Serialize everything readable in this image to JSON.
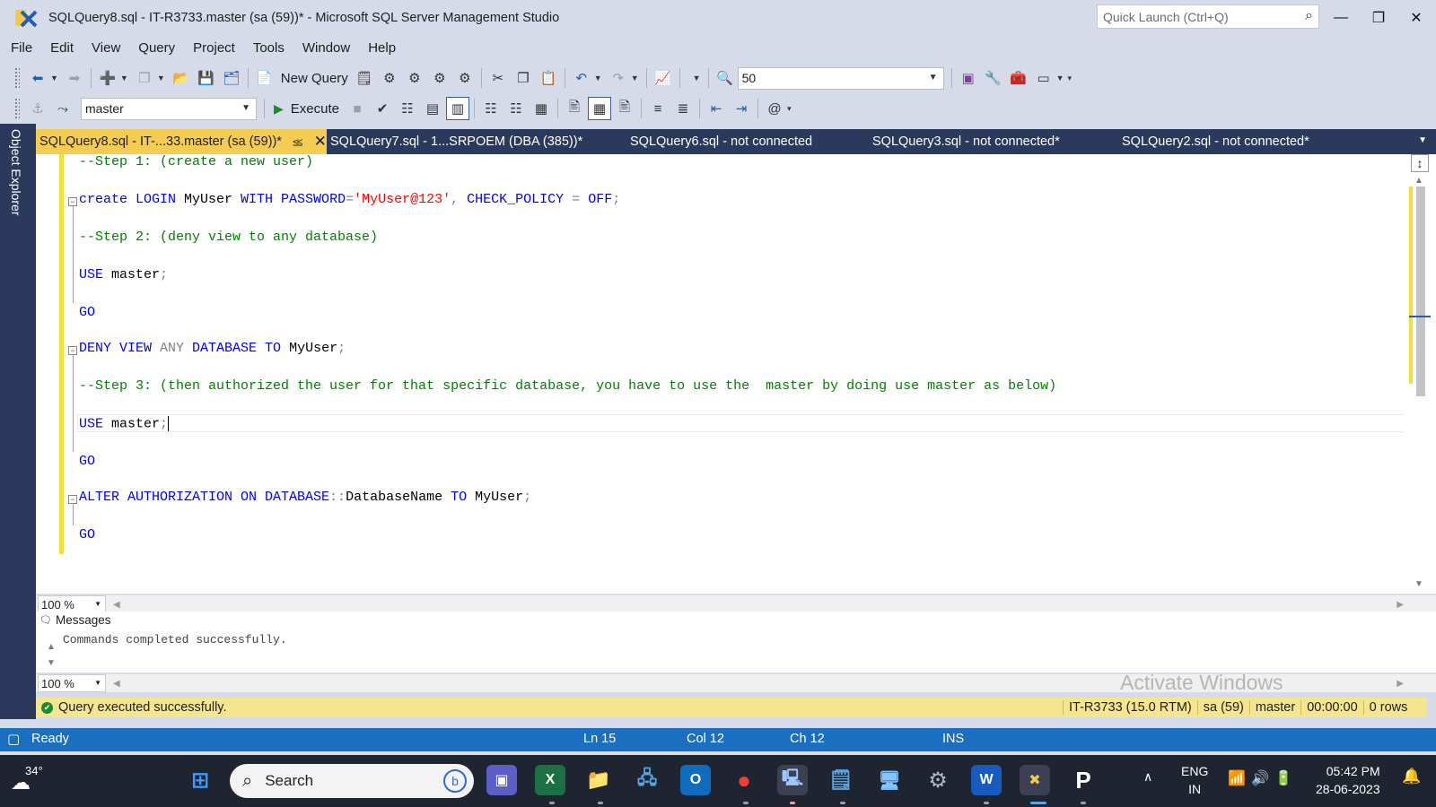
{
  "window": {
    "title": "SQLQuery8.sql - IT-R3733.master (sa (59))* - Microsoft SQL Server Management Studio",
    "quick_launch_placeholder": "Quick Launch (Ctrl+Q)"
  },
  "menu": [
    "File",
    "Edit",
    "View",
    "Query",
    "Project",
    "Tools",
    "Window",
    "Help"
  ],
  "toolbar1": {
    "new_query_label": "New Query",
    "results_combo_value": "50"
  },
  "toolbar2": {
    "database_combo_value": "master",
    "execute_label": "Execute"
  },
  "left_rail": {
    "object_explorer_label": "Object Explorer"
  },
  "tabs": [
    {
      "label": "SQLQuery8.sql - IT-...33.master (sa (59))*",
      "active": true
    },
    {
      "label": "SQLQuery7.sql - 1...SRPOEM (DBA (385))*",
      "active": false
    },
    {
      "label": "SQLQuery6.sql - not connected",
      "active": false
    },
    {
      "label": "SQLQuery3.sql - not connected*",
      "active": false
    },
    {
      "label": "SQLQuery2.sql - not connected*",
      "active": false
    }
  ],
  "editor": {
    "lines": {
      "l1": "--Step 1: (create a new user)",
      "l2_a": "create LOGIN",
      "l2_b": " MyUser ",
      "l2_c": "WITH PASSWORD",
      "l2_d": "=",
      "l2_e": "'MyUser@123'",
      "l2_f": ", ",
      "l2_g": "CHECK_POLICY",
      "l2_h": " = ",
      "l2_i": "OFF",
      "l2_j": ";",
      "l3": "--Step 2: (deny view to any database)",
      "l4_a": "USE",
      "l4_b": " master",
      "l4_c": ";",
      "l5": "GO",
      "l6_a": "DENY VIEW",
      "l6_b": " ANY ",
      "l6_c": "DATABASE TO",
      "l6_d": " MyUser",
      "l6_e": ";",
      "l7": "--Step 3: (then authorized the user for that specific database, you have to use the  master by doing use master as below)",
      "l8_a": "USE",
      "l8_b": " master",
      "l8_c": ";",
      "l9": "GO",
      "l10_a": "ALTER AUTHORIZATION ON DATABASE",
      "l10_b": "::",
      "l10_c": "DatabaseName ",
      "l10_d": "TO",
      "l10_e": " MyUser",
      "l10_f": ";",
      "l11": "GO"
    },
    "zoom": "100 %"
  },
  "results": {
    "tab_label": "Messages",
    "message": "Commands completed successfully.",
    "zoom": "100 %"
  },
  "watermark": "Activate Windows",
  "query_status": {
    "message": "Query executed successfully.",
    "server": "IT-R3733 (15.0 RTM)",
    "login": "sa (59)",
    "database": "master",
    "elapsed": "00:00:00",
    "rows": "0 rows"
  },
  "status_bar": {
    "state": "Ready",
    "ln": "Ln 15",
    "col": "Col 12",
    "ch": "Ch 12",
    "mode": "INS"
  },
  "taskbar": {
    "temperature": "34°",
    "search_label": "Search",
    "lang_top": "ENG",
    "lang_bottom": "IN",
    "time": "05:42 PM",
    "date": "28-06-2023"
  },
  "colors": {
    "keyword": "#0000ff",
    "comment": "#008000",
    "string": "#ff0000",
    "active_tab": "#f5cc52",
    "status_bar": "#1b6fc0"
  }
}
